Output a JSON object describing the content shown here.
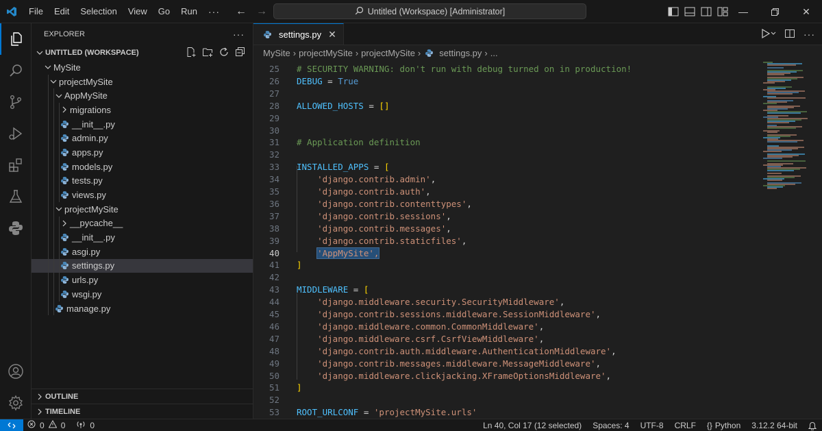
{
  "menu": [
    "File",
    "Edit",
    "Selection",
    "View",
    "Go",
    "Run"
  ],
  "command_center": "Untitled (Workspace) [Administrator]",
  "explorer": {
    "title": "EXPLORER",
    "workspace": "UNTITLED (WORKSPACE)",
    "tree": [
      {
        "label": "MySite",
        "type": "folder-open",
        "depth": 0
      },
      {
        "label": "projectMySite",
        "type": "folder-open",
        "depth": 1
      },
      {
        "label": "AppMySite",
        "type": "folder-open",
        "depth": 2
      },
      {
        "label": "migrations",
        "type": "folder-closed",
        "depth": 3
      },
      {
        "label": "__init__.py",
        "type": "python-file",
        "depth": 3
      },
      {
        "label": "admin.py",
        "type": "python-file",
        "depth": 3
      },
      {
        "label": "apps.py",
        "type": "python-file",
        "depth": 3
      },
      {
        "label": "models.py",
        "type": "python-file",
        "depth": 3
      },
      {
        "label": "tests.py",
        "type": "python-file",
        "depth": 3
      },
      {
        "label": "views.py",
        "type": "python-file",
        "depth": 3
      },
      {
        "label": "projectMySite",
        "type": "folder-open",
        "depth": 2
      },
      {
        "label": "__pycache__",
        "type": "folder-closed",
        "depth": 3
      },
      {
        "label": "__init__.py",
        "type": "python-file",
        "depth": 3
      },
      {
        "label": "asgi.py",
        "type": "python-file",
        "depth": 3
      },
      {
        "label": "settings.py",
        "type": "python-file",
        "depth": 3,
        "selected": true
      },
      {
        "label": "urls.py",
        "type": "python-file",
        "depth": 3
      },
      {
        "label": "wsgi.py",
        "type": "python-file",
        "depth": 3
      },
      {
        "label": "manage.py",
        "type": "python-file",
        "depth": 2
      }
    ],
    "outline": "OUTLINE",
    "timeline": "TIMELINE"
  },
  "tab": {
    "label": "settings.py"
  },
  "breadcrumb": [
    "MySite",
    "projectMySite",
    "projectMySite",
    "settings.py",
    "..."
  ],
  "code_lines": [
    {
      "n": "25",
      "tokens": [
        {
          "t": "# SECURITY WARNING: don't run with debug turned on in production!",
          "c": "c-comment"
        }
      ]
    },
    {
      "n": "26",
      "tokens": [
        {
          "t": "DEBUG",
          "c": "c-var"
        },
        {
          "t": " = ",
          "c": "c-op"
        },
        {
          "t": "True",
          "c": "c-kw"
        }
      ]
    },
    {
      "n": "27",
      "tokens": []
    },
    {
      "n": "28",
      "tokens": [
        {
          "t": "ALLOWED_HOSTS",
          "c": "c-var"
        },
        {
          "t": " = ",
          "c": "c-op"
        },
        {
          "t": "[]",
          "c": "c-br"
        }
      ]
    },
    {
      "n": "29",
      "tokens": []
    },
    {
      "n": "30",
      "tokens": []
    },
    {
      "n": "31",
      "tokens": [
        {
          "t": "# Application definition",
          "c": "c-comment"
        }
      ]
    },
    {
      "n": "32",
      "tokens": []
    },
    {
      "n": "33",
      "tokens": [
        {
          "t": "INSTALLED_APPS",
          "c": "c-var"
        },
        {
          "t": " = ",
          "c": "c-op"
        },
        {
          "t": "[",
          "c": "c-br"
        }
      ]
    },
    {
      "n": "34",
      "tokens": [
        {
          "t": "    ",
          "c": "c-op"
        },
        {
          "t": "'django.contrib.admin'",
          "c": "c-str"
        },
        {
          "t": ",",
          "c": "c-op"
        }
      ]
    },
    {
      "n": "35",
      "tokens": [
        {
          "t": "    ",
          "c": "c-op"
        },
        {
          "t": "'django.contrib.auth'",
          "c": "c-str"
        },
        {
          "t": ",",
          "c": "c-op"
        }
      ]
    },
    {
      "n": "36",
      "tokens": [
        {
          "t": "    ",
          "c": "c-op"
        },
        {
          "t": "'django.contrib.contenttypes'",
          "c": "c-str"
        },
        {
          "t": ",",
          "c": "c-op"
        }
      ]
    },
    {
      "n": "37",
      "tokens": [
        {
          "t": "    ",
          "c": "c-op"
        },
        {
          "t": "'django.contrib.sessions'",
          "c": "c-str"
        },
        {
          "t": ",",
          "c": "c-op"
        }
      ]
    },
    {
      "n": "38",
      "tokens": [
        {
          "t": "    ",
          "c": "c-op"
        },
        {
          "t": "'django.contrib.messages'",
          "c": "c-str"
        },
        {
          "t": ",",
          "c": "c-op"
        }
      ]
    },
    {
      "n": "39",
      "tokens": [
        {
          "t": "    ",
          "c": "c-op"
        },
        {
          "t": "'django.contrib.staticfiles'",
          "c": "c-str"
        },
        {
          "t": ",",
          "c": "c-op"
        }
      ]
    },
    {
      "n": "40",
      "current": true,
      "tokens": [
        {
          "t": "    ",
          "c": "c-op"
        },
        {
          "t": "'AppMySite',",
          "c": "c-str sel"
        }
      ]
    },
    {
      "n": "41",
      "tokens": [
        {
          "t": "]",
          "c": "c-br"
        }
      ]
    },
    {
      "n": "42",
      "tokens": []
    },
    {
      "n": "43",
      "tokens": [
        {
          "t": "MIDDLEWARE",
          "c": "c-var"
        },
        {
          "t": " = ",
          "c": "c-op"
        },
        {
          "t": "[",
          "c": "c-br"
        }
      ]
    },
    {
      "n": "44",
      "tokens": [
        {
          "t": "    ",
          "c": "c-op"
        },
        {
          "t": "'django.middleware.security.SecurityMiddleware'",
          "c": "c-str"
        },
        {
          "t": ",",
          "c": "c-op"
        }
      ]
    },
    {
      "n": "45",
      "tokens": [
        {
          "t": "    ",
          "c": "c-op"
        },
        {
          "t": "'django.contrib.sessions.middleware.SessionMiddleware'",
          "c": "c-str"
        },
        {
          "t": ",",
          "c": "c-op"
        }
      ]
    },
    {
      "n": "46",
      "tokens": [
        {
          "t": "    ",
          "c": "c-op"
        },
        {
          "t": "'django.middleware.common.CommonMiddleware'",
          "c": "c-str"
        },
        {
          "t": ",",
          "c": "c-op"
        }
      ]
    },
    {
      "n": "47",
      "tokens": [
        {
          "t": "    ",
          "c": "c-op"
        },
        {
          "t": "'django.middleware.csrf.CsrfViewMiddleware'",
          "c": "c-str"
        },
        {
          "t": ",",
          "c": "c-op"
        }
      ]
    },
    {
      "n": "48",
      "tokens": [
        {
          "t": "    ",
          "c": "c-op"
        },
        {
          "t": "'django.contrib.auth.middleware.AuthenticationMiddleware'",
          "c": "c-str"
        },
        {
          "t": ",",
          "c": "c-op"
        }
      ]
    },
    {
      "n": "49",
      "tokens": [
        {
          "t": "    ",
          "c": "c-op"
        },
        {
          "t": "'django.contrib.messages.middleware.MessageMiddleware'",
          "c": "c-str"
        },
        {
          "t": ",",
          "c": "c-op"
        }
      ]
    },
    {
      "n": "50",
      "tokens": [
        {
          "t": "    ",
          "c": "c-op"
        },
        {
          "t": "'django.middleware.clickjacking.XFrameOptionsMiddleware'",
          "c": "c-str"
        },
        {
          "t": ",",
          "c": "c-op"
        }
      ]
    },
    {
      "n": "51",
      "tokens": [
        {
          "t": "]",
          "c": "c-br"
        }
      ]
    },
    {
      "n": "52",
      "tokens": []
    },
    {
      "n": "53",
      "tokens": [
        {
          "t": "ROOT_URLCONF",
          "c": "c-var"
        },
        {
          "t": " = ",
          "c": "c-op"
        },
        {
          "t": "'projectMySite.urls'",
          "c": "c-str"
        }
      ]
    }
  ],
  "status": {
    "errors": "0",
    "warnings": "0",
    "ports": "0",
    "position": "Ln 40, Col 17 (12 selected)",
    "spaces": "Spaces: 4",
    "encoding": "UTF-8",
    "eol": "CRLF",
    "language": "Python",
    "interpreter": "3.12.2 64-bit"
  },
  "colors": {
    "accent": "#0078d4",
    "selection": "#264f78",
    "sidebar_bg": "#181818",
    "editor_bg": "#1f1f1f"
  }
}
